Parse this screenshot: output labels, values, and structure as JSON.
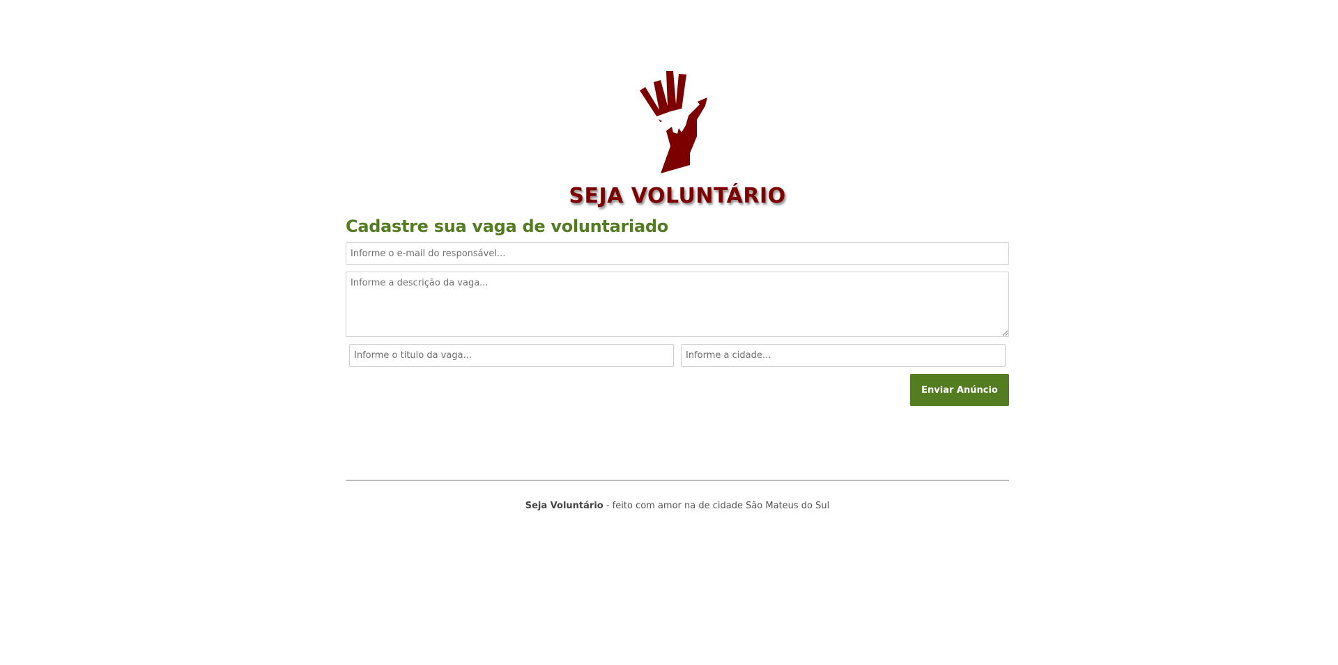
{
  "brand": {
    "title": "SEJA VOLUNTÁRIO",
    "logo_icon": "hands-icon",
    "color": "#7d0000"
  },
  "form": {
    "title": "Cadastre sua vaga de voluntariado",
    "email_placeholder": "Informe o e-mail do responsável...",
    "description_placeholder": "Informe a descrição da vaga...",
    "job_title_placeholder": "Informe o titulo da vaga...",
    "city_placeholder": "Informe a cidade...",
    "submit_label": "Enviar Anúncio",
    "accent_color": "#537d20"
  },
  "footer": {
    "brand": "Seja Voluntário",
    "text": " - feito com amor na de cidade São Mateus do Sul"
  }
}
